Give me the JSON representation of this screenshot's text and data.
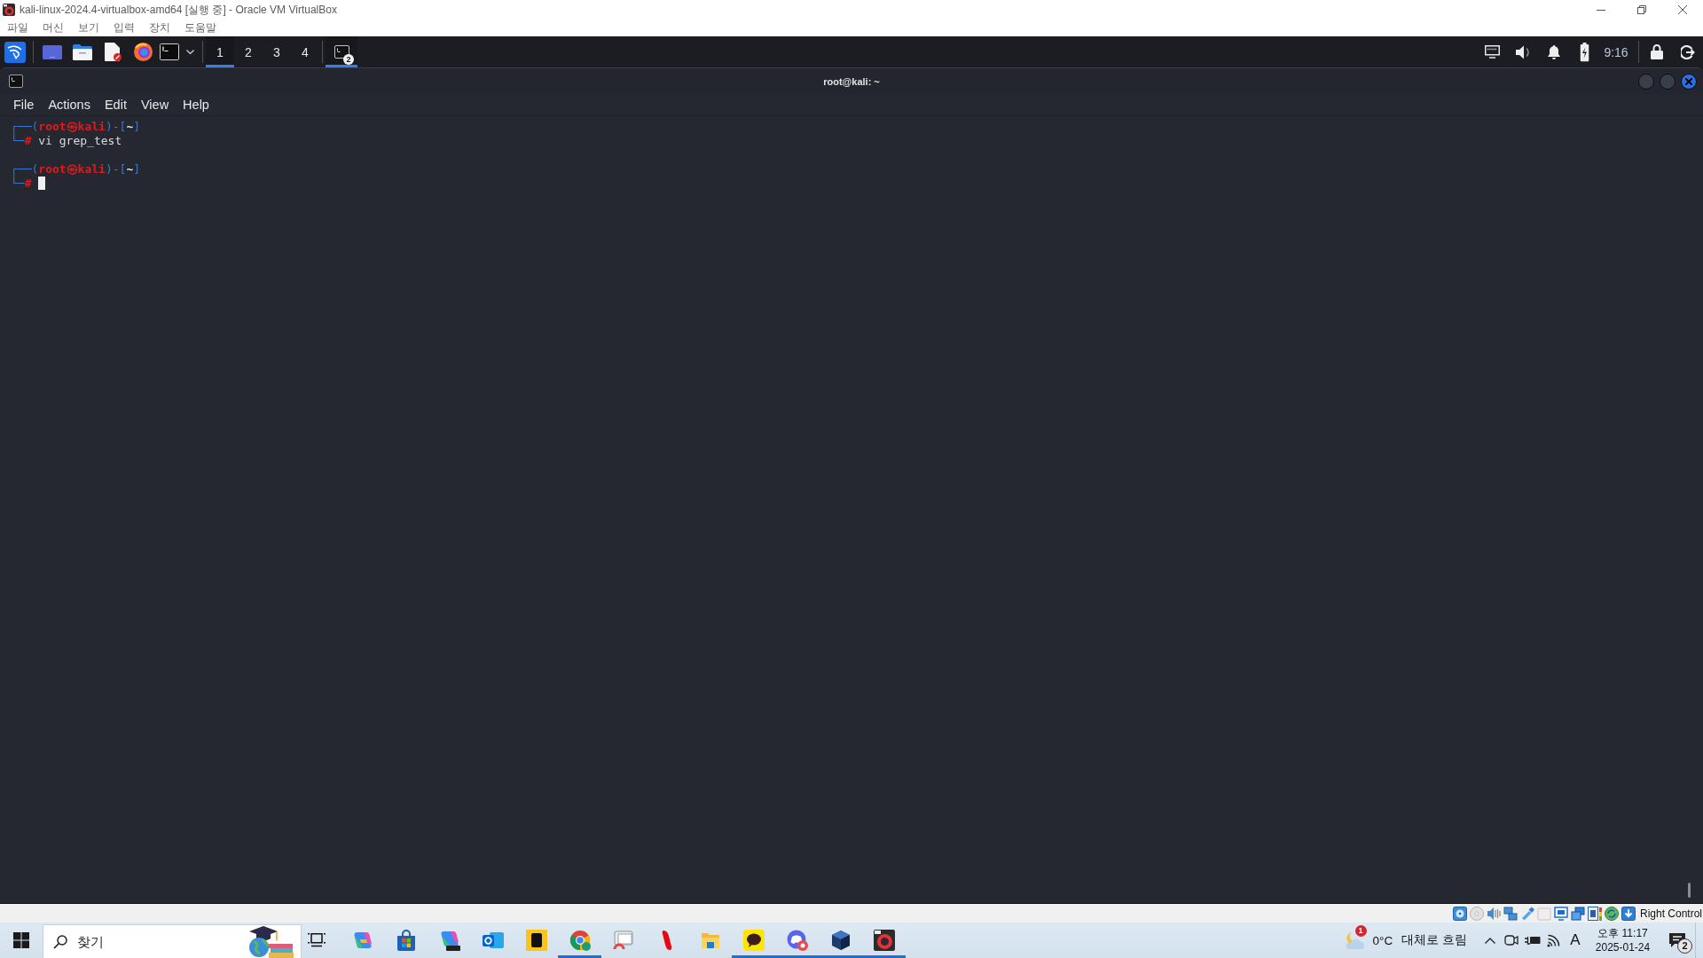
{
  "window": {
    "title": "kali-linux-2024.4-virtualbox-amd64 [실행 중] - Oracle VM VirtualBox"
  },
  "menu_bar": {
    "items": [
      "파일",
      "머신",
      "보기",
      "입력",
      "장치",
      "도움말"
    ]
  },
  "guest_panel": {
    "workspaces": [
      {
        "label": "1",
        "selected": true
      },
      {
        "label": "2",
        "selected": false
      },
      {
        "label": "3",
        "selected": false
      },
      {
        "label": "4",
        "selected": false
      }
    ],
    "window_buttons": [
      {
        "badge": "2",
        "selected": true
      }
    ],
    "clock": "9:16"
  },
  "terminal": {
    "title": "root@kali: ~",
    "menu": [
      "File",
      "Actions",
      "Edit",
      "View",
      "Help"
    ],
    "prompts": [
      {
        "header": [
          {
            "kind": "frame",
            "text": "┌──("
          },
          {
            "kind": "user",
            "text": "root㉿kali"
          },
          {
            "kind": "frame",
            "text": ")-["
          },
          {
            "kind": "path",
            "text": "~"
          },
          {
            "kind": "frame",
            "text": "]"
          }
        ],
        "marker": [
          {
            "kind": "frame",
            "text": "└─"
          },
          {
            "kind": "user",
            "text": "#"
          }
        ],
        "command": "vi grep_test"
      },
      {
        "header": [
          {
            "kind": "frame",
            "text": "┌──("
          },
          {
            "kind": "user",
            "text": "root㉿kali"
          },
          {
            "kind": "frame",
            "text": ")-["
          },
          {
            "kind": "path",
            "text": "~"
          },
          {
            "kind": "frame",
            "text": "]"
          }
        ],
        "marker": [
          {
            "kind": "frame",
            "text": "└─"
          },
          {
            "kind": "user",
            "text": "#"
          }
        ],
        "cursor": true
      }
    ]
  },
  "vm_status_bar": {
    "host_key": "Right Control"
  },
  "taskbar": {
    "search": {
      "placeholder": "찾기"
    },
    "apps": [
      {
        "running": false
      },
      {
        "running": false
      },
      {
        "running": false
      },
      {
        "running": false
      },
      {
        "running": false
      },
      {
        "running": true
      },
      {
        "running": false
      },
      {
        "running": false
      },
      {
        "running": false
      },
      {
        "running": true
      },
      {
        "running": true
      },
      {
        "running": true
      },
      {
        "running": true
      }
    ],
    "weather": {
      "badge": "1",
      "temperature": "0°C",
      "condition": "대체로 흐림"
    },
    "input_mode": "A",
    "clock": {
      "time": "오후 11:17",
      "date": "2025-01-24"
    },
    "notifications": {
      "badge": "2"
    }
  }
}
